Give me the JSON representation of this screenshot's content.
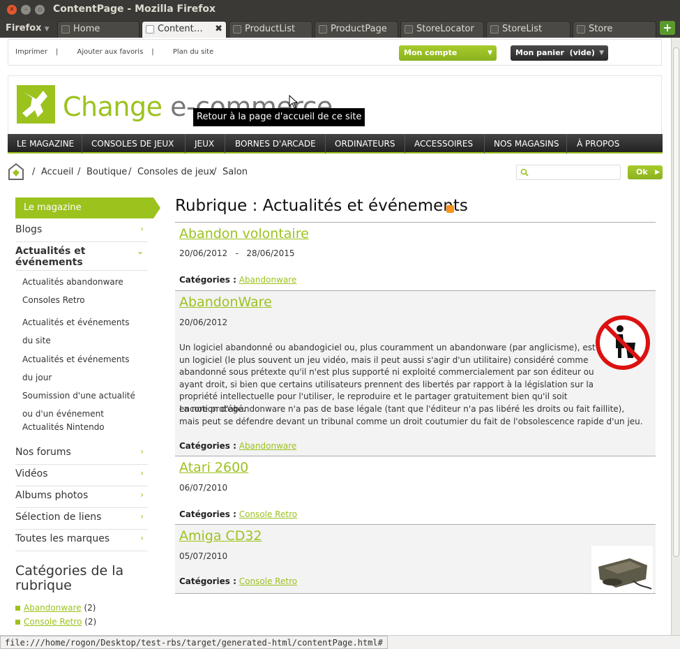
{
  "window": {
    "title": "ContentPage - Mozilla Firefox"
  },
  "browser": {
    "menu_label": "Firefox",
    "tabs": [
      {
        "label": "Home",
        "active": false
      },
      {
        "label": "Content…",
        "active": true
      },
      {
        "label": "ProductList",
        "active": false
      },
      {
        "label": "ProductPage",
        "active": false
      },
      {
        "label": "StoreLocator",
        "active": false
      },
      {
        "label": "StoreList",
        "active": false
      },
      {
        "label": "Store",
        "active": false
      }
    ],
    "status_url": "file:///home/rogon/Desktop/test-rbs/target/generated-html/contentPage.html#"
  },
  "topbar": {
    "links": [
      "Imprimer",
      "Ajouter aux favoris",
      "Plan du site"
    ],
    "separator": "|",
    "account_label": "Mon compte",
    "cart_label": "Mon panier  (vide)"
  },
  "logo": {
    "text_main": "Change",
    "text_second": "e-commerce",
    "tooltip": "Retour à la page d'accueil de ce site"
  },
  "mainnav": [
    "LE MAGAZINE",
    "CONSOLES DE JEUX",
    "JEUX",
    "BORNES D'ARCADE",
    "ORDINATEURS",
    "ACCESSOIRES",
    "NOS MAGASINS",
    "À PROPOS"
  ],
  "breadcrumb": {
    "separator": "/",
    "items": [
      "Accueil",
      "Boutique",
      "Consoles de jeux",
      "Salon"
    ]
  },
  "search": {
    "button_label": "Ok",
    "value": ""
  },
  "sidebar": {
    "heading": "Le magazine",
    "items": [
      {
        "label": "Blogs"
      },
      {
        "label": "Actualités et événements",
        "expanded": true
      },
      {
        "label": "Nos forums"
      },
      {
        "label": "Vidéos"
      },
      {
        "label": "Albums photos"
      },
      {
        "label": "Sélection de liens"
      },
      {
        "label": "Toutes les marques"
      }
    ],
    "subitems": [
      "Actualités abandonware",
      "Consoles Retro",
      "Actualités et événements du site",
      "Actualités et événements du jour",
      "Soumission d'une actualité ou d'un événement",
      "Actualités Nintendo"
    ],
    "categories_title": "Catégories de la rubrique",
    "categories": [
      {
        "name": "Abandonware",
        "count": "(2)"
      },
      {
        "name": "Console Retro",
        "count": "(2)"
      }
    ]
  },
  "main": {
    "title": "Rubrique : Actualités et événements",
    "categories_label": "Catégories :",
    "articles": [
      {
        "title": "Abandon volontaire",
        "date": "20/06/2012   -   28/06/2015",
        "category": "Abandonware"
      },
      {
        "title": "AbandonWare",
        "date": "20/06/2012",
        "category": "Abandonware",
        "body": "Un logiciel abandonné ou abandogiciel ou, plus couramment un abandonware (par anglicisme), est un logiciel (le plus souvent un jeu vidéo, mais il peut aussi s'agir d'un utilitaire) considéré comme abandonné sous prétexte qu'il n'est plus supporté ni exploité commercialement par son éditeur ou ayant droit, si bien que certains utilisateurs prennent des libertés par rapport à la législation sur la propriété intellectuelle pour l'utiliser, le reproduire et le partager gratuitement bien qu'il soit encore protégé.",
        "body2": "La notion d'abandonware n'a pas de base légale (tant que l'éditeur n'a pas libéré les droits ou fait faillite), mais peut se défendre devant un tribunal comme un droit coutumier du fait de l'obsolescence rapide d'un jeu."
      },
      {
        "title": "Atari 2600",
        "date": "06/07/2010",
        "category": "Console Retro"
      },
      {
        "title": "Amiga CD32",
        "date": "05/07/2010",
        "category": "Console Retro"
      }
    ]
  },
  "colors": {
    "accent": "#9cc21e",
    "nav_bg": "#333333",
    "firefox_chrome": "#3a3935"
  }
}
